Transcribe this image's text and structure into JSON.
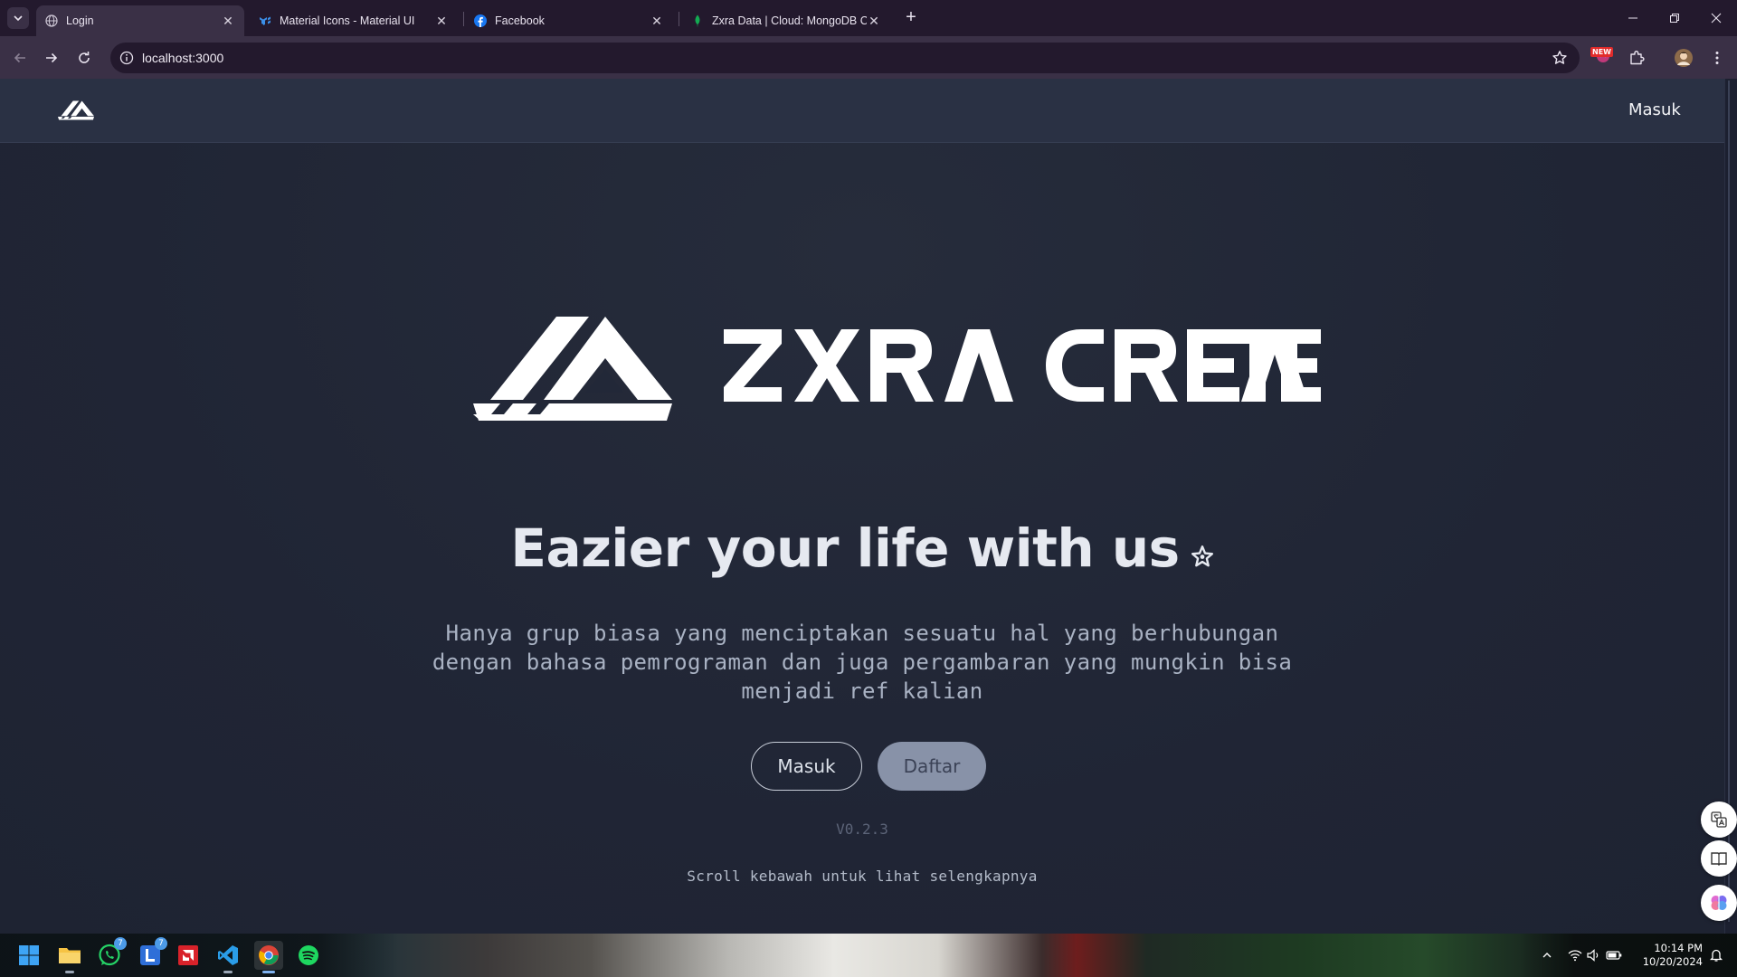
{
  "browser": {
    "tabs": [
      {
        "title": "Login",
        "favicon": "globe-icon",
        "active": true
      },
      {
        "title": "Material Icons - Material UI",
        "favicon": "mui-icon",
        "active": false
      },
      {
        "title": "Facebook",
        "favicon": "facebook-icon",
        "active": false
      },
      {
        "title": "Zxra Data | Cloud: MongoDB Cl",
        "favicon": "mongodb-leaf-icon",
        "active": false
      }
    ],
    "new_tab_label": "+",
    "url": "localhost:3000",
    "extension_badge": "NEW"
  },
  "site": {
    "nav_login": "Masuk",
    "tagline": "Eazier your life with us",
    "description": "Hanya grup biasa yang menciptakan sesuatu hal yang berhubungan dengan bahasa pemrograman dan juga pergambaran yang mungkin bisa menjadi ref kalian",
    "login_button": "Masuk",
    "register_button": "Daftar",
    "version": "V0.2.3",
    "scroll_hint": "Scroll kebawah untuk lihat selengkapnya",
    "brand_logo_text": "ZXRA CREATE"
  },
  "taskbar": {
    "whatsapp_badge": "7",
    "lync_badge": "7",
    "time": "10:14 PM",
    "date": "10/20/2024"
  },
  "colors": {
    "page_bg": "#202535",
    "nav_bg": "#2a3144",
    "accent_button": "#8892a8",
    "browser_frame": "#3a3046"
  }
}
